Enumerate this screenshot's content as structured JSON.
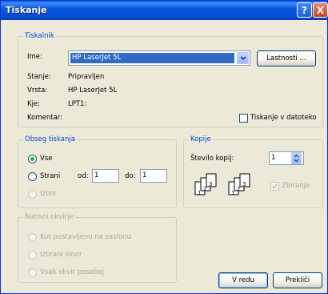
{
  "window": {
    "title": "Tiskanje"
  },
  "titlebar": {
    "help_glyph": "?",
    "close_glyph": "X"
  },
  "printer": {
    "legend": "Tiskalnik",
    "name_label": "Ime:",
    "name_value": "HP LaserJet 5L",
    "properties_button": "Lastnosti ...",
    "status_label": "Stanje:",
    "status_value": "Pripravljen",
    "type_label": "Vrsta:",
    "type_value": "HP LaserJet 5L",
    "where_label": "Kje:",
    "where_value": "LPT1:",
    "comment_label": "Komentar:",
    "print_to_file": "Tiskanje v datoteko"
  },
  "range": {
    "legend": "Obseg tiskanja",
    "all": "Vse",
    "pages": "Strani",
    "from_label": "od:",
    "from_value": "1",
    "to_label": "do:",
    "to_value": "1",
    "selection": "Izbor"
  },
  "copies": {
    "legend": "Kopije",
    "count_label": "Število kopij:",
    "count_value": "1",
    "collate": "Zbiranje",
    "page_nums": [
      "1",
      "2",
      "3"
    ]
  },
  "frames": {
    "legend": "Natisni okvirje",
    "as_shown": "Kot postavljeno na zaslonu",
    "selected": "Izbrani okvir",
    "each": "Vsak okvir posebej"
  },
  "footer": {
    "ok": "V redu",
    "cancel": "Prekliči"
  },
  "colors": {
    "titlebar": "#0a58dd",
    "legend_text": "#0046d5",
    "selection": "#316ac5"
  }
}
